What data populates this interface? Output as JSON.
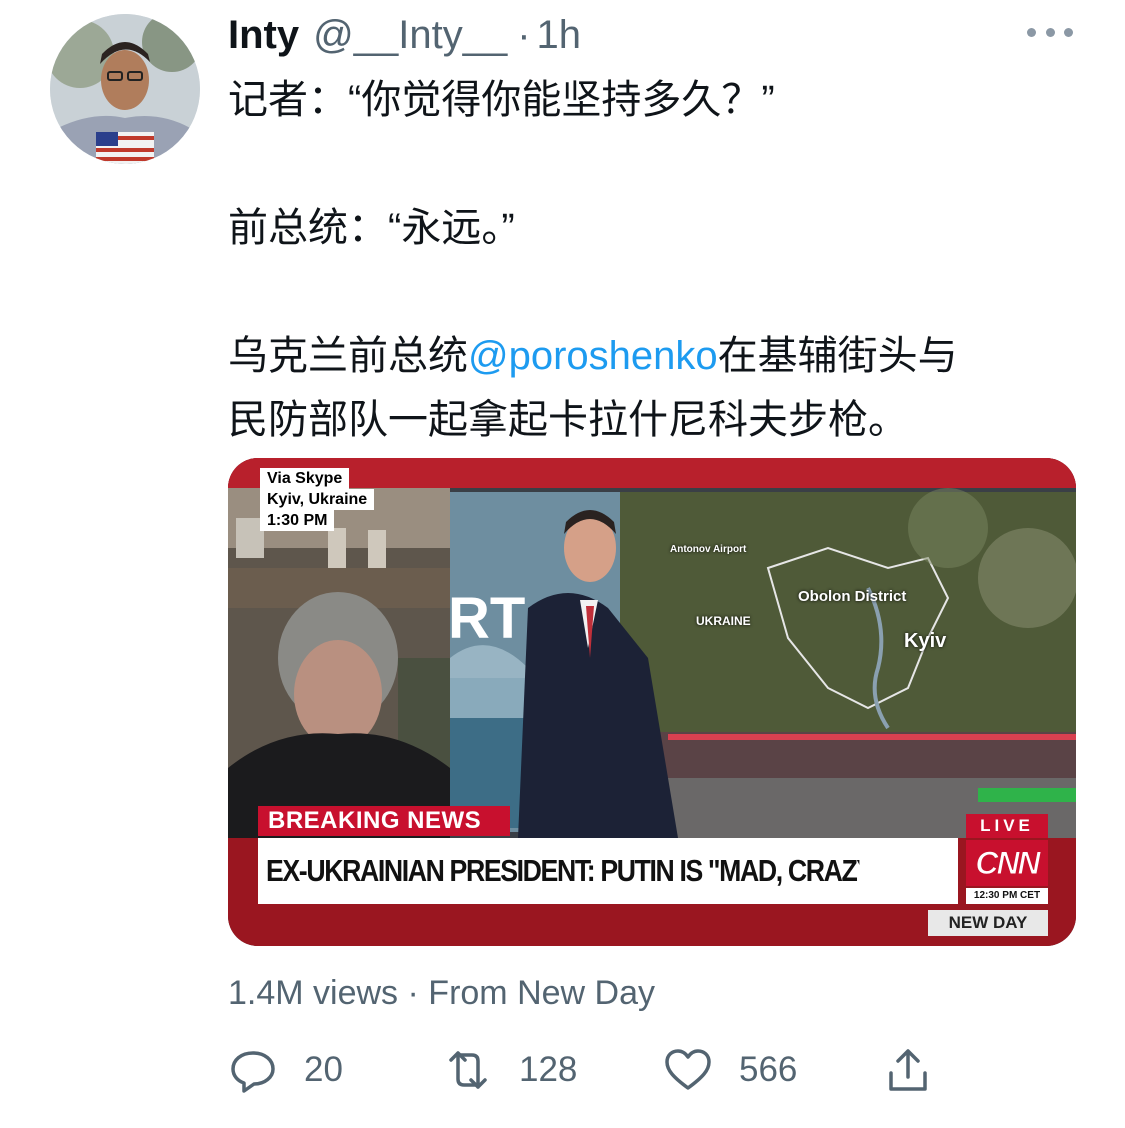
{
  "tweet": {
    "author_name": "Inty",
    "author_handle": "@__Inty__",
    "separator": "·",
    "time": "1h",
    "avatar_icon": "profile-photo",
    "more_icon": "more-horizontal-icon",
    "text_lines": {
      "line1": "记者：“你觉得你能坚持多久？”",
      "line2": "前总统：“永远。”",
      "line3_before": "乌克兰前总统",
      "line3_mention": "@poroshenko",
      "line3_after": "在基辅街头与",
      "line4": "民防部队一起拿起卡拉什尼科夫步枪。"
    },
    "mention_color": "#1d9bf0"
  },
  "video": {
    "via": "Via Skype",
    "location": "Kyiv, Ukraine",
    "time": "1:30 PM",
    "breaking": "BREAKING NEWS",
    "headline": "EX-UKRAINIAN PRESIDENT: PUTIN IS \"MAD, CRAZY\" TO COME KILL US",
    "live": "LIVE",
    "network": "CNN",
    "network_time": "12:30 PM CET",
    "show": "NEW DAY",
    "studio_text": "RT",
    "map_labels": {
      "airport": "Antonov Airport",
      "district": "Obolon District",
      "country": "UKRAINE",
      "city": "Kyiv"
    },
    "brand_color": "#c8102e"
  },
  "meta": {
    "views": "1.4M views",
    "separator": "·",
    "source": "From New Day"
  },
  "actions": {
    "reply_count": "20",
    "retweet_count": "128",
    "like_count": "566",
    "icons": [
      "reply-icon",
      "retweet-icon",
      "like-icon",
      "share-icon"
    ]
  }
}
